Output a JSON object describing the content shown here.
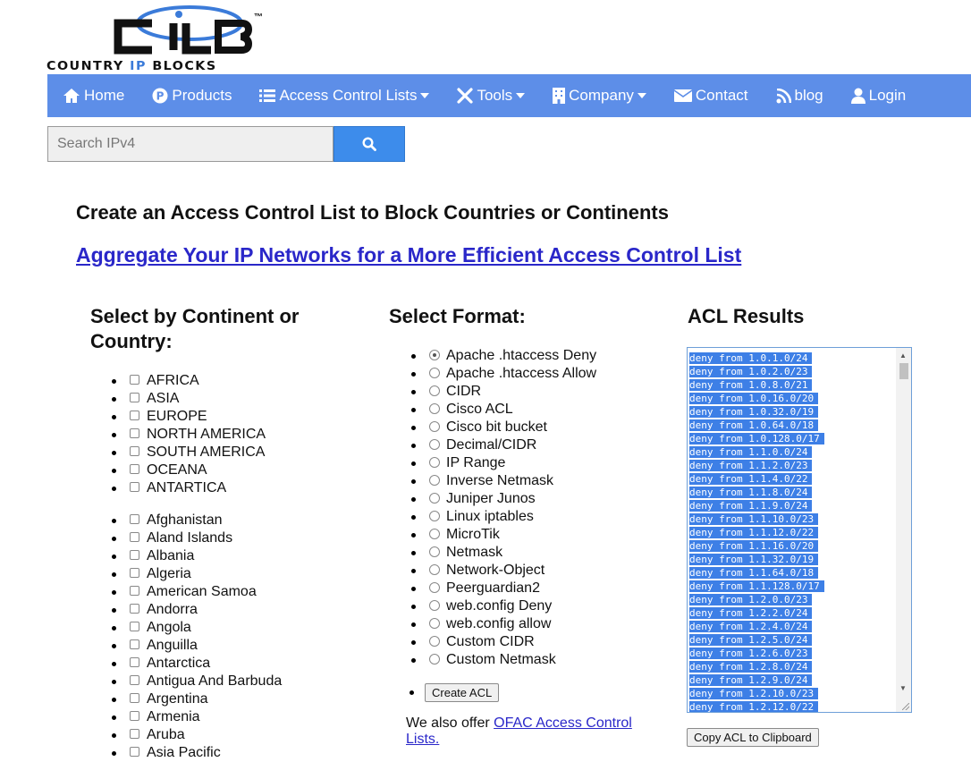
{
  "logo": {
    "wordmark_pre": "COUNTRY ",
    "wordmark_ip": "IP",
    "wordmark_post": " BLOCKS",
    "tm": "™"
  },
  "nav": {
    "items": [
      {
        "label": "Home",
        "icon": "home-icon"
      },
      {
        "label": "Products",
        "icon": "products-p-icon"
      },
      {
        "label": "Access Control Lists",
        "icon": "list-icon",
        "dropdown": true
      },
      {
        "label": "Tools",
        "icon": "tools-icon",
        "dropdown": true
      },
      {
        "label": "Company",
        "icon": "building-icon",
        "dropdown": true
      },
      {
        "label": "Contact",
        "icon": "envelope-icon"
      },
      {
        "label": "blog",
        "icon": "rss-icon"
      },
      {
        "label": "Login",
        "icon": "user-icon"
      }
    ]
  },
  "search": {
    "placeholder": "Search IPv4",
    "value": ""
  },
  "page": {
    "title": "Create an Access Control List to Block Countries or Continents",
    "aggregate_link": "Aggregate Your IP Networks for a More Efficient Access Control List"
  },
  "continents": {
    "heading": "Select by Continent or Country:",
    "items": [
      "AFRICA",
      "ASIA",
      "EUROPE",
      "NORTH AMERICA",
      "SOUTH AMERICA",
      "OCEANA",
      "ANTARTICA"
    ]
  },
  "countries": {
    "items": [
      "Afghanistan",
      "Aland Islands",
      "Albania",
      "Algeria",
      "American Samoa",
      "Andorra",
      "Angola",
      "Anguilla",
      "Antarctica",
      "Antigua And Barbuda",
      "Argentina",
      "Armenia",
      "Aruba",
      "Asia Pacific"
    ]
  },
  "formats": {
    "heading": "Select Format:",
    "selected": "Apache .htaccess Deny",
    "items": [
      "Apache .htaccess Deny",
      "Apache .htaccess Allow",
      "CIDR",
      "Cisco ACL",
      "Cisco bit bucket",
      "Decimal/CIDR",
      "IP Range",
      "Inverse Netmask",
      "Juniper Junos",
      "Linux iptables",
      "MicroTik",
      "Netmask",
      "Network-Object",
      "Peerguardian2",
      "web.config Deny",
      "web.config allow",
      "Custom CIDR",
      "Custom Netmask"
    ],
    "create_label": "Create ACL"
  },
  "ofac": {
    "prefix": "We also offer ",
    "link": "OFAC Access Control Lists."
  },
  "results": {
    "heading": "ACL Results",
    "lines": [
      "deny from 1.0.1.0/24",
      "deny from 1.0.2.0/23",
      "deny from 1.0.8.0/21",
      "deny from 1.0.16.0/20",
      "deny from 1.0.32.0/19",
      "deny from 1.0.64.0/18",
      "deny from 1.0.128.0/17",
      "deny from 1.1.0.0/24",
      "deny from 1.1.2.0/23",
      "deny from 1.1.4.0/22",
      "deny from 1.1.8.0/24",
      "deny from 1.1.9.0/24",
      "deny from 1.1.10.0/23",
      "deny from 1.1.12.0/22",
      "deny from 1.1.16.0/20",
      "deny from 1.1.32.0/19",
      "deny from 1.1.64.0/18",
      "deny from 1.1.128.0/17",
      "deny from 1.2.0.0/23",
      "deny from 1.2.2.0/24",
      "deny from 1.2.4.0/24",
      "deny from 1.2.5.0/24",
      "deny from 1.2.6.0/23",
      "deny from 1.2.8.0/24",
      "deny from 1.2.9.0/24",
      "deny from 1.2.10.0/23",
      "deny from 1.2.12.0/22"
    ],
    "copy_label": "Copy ACL to Clipboard"
  },
  "colors": {
    "nav_bg": "#5d8ee8",
    "search_button": "#3d8ceb",
    "link": "#2a27c9",
    "selection": "#3d7fe6"
  }
}
